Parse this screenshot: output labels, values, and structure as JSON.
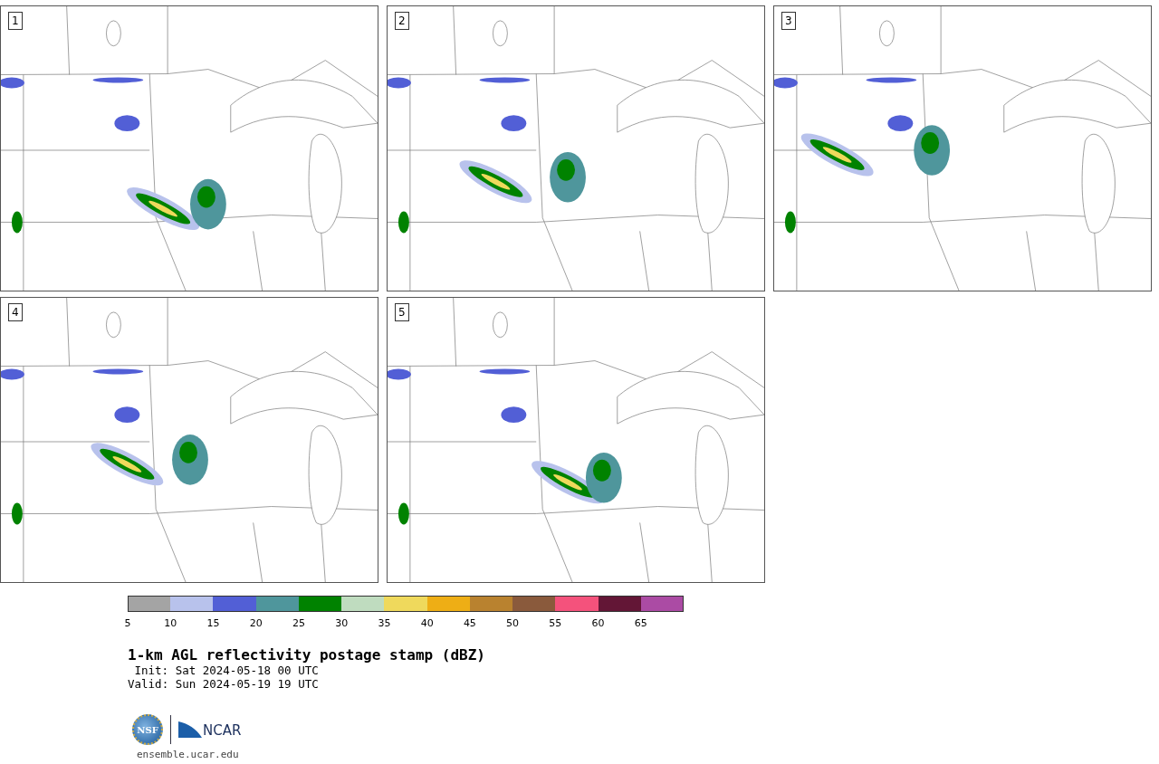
{
  "panels": [
    {
      "label": "1"
    },
    {
      "label": "2"
    },
    {
      "label": "3"
    },
    {
      "label": "4"
    },
    {
      "label": "5"
    }
  ],
  "colorbar": [
    {
      "label": "5",
      "color": "#a4a4a4"
    },
    {
      "label": "10",
      "color": "#b8c2ec"
    },
    {
      "label": "15",
      "color": "#525fd6"
    },
    {
      "label": "20",
      "color": "#4f969c"
    },
    {
      "label": "25",
      "color": "#008200"
    },
    {
      "label": "30",
      "color": "#bfdcbf"
    },
    {
      "label": "35",
      "color": "#efd95c"
    },
    {
      "label": "40",
      "color": "#eeae15"
    },
    {
      "label": "45",
      "color": "#b9822f"
    },
    {
      "label": "50",
      "color": "#8a5a3c"
    },
    {
      "label": "55",
      "color": "#f4527c"
    },
    {
      "label": "60",
      "color": "#631636"
    },
    {
      "label": "65",
      "color": "#ab4ba4"
    }
  ],
  "title": "1-km AGL reflectivity postage stamp (dBZ)",
  "init": "Init: Sat 2024-05-18 00 UTC",
  "valid": "Valid: Sun 2024-05-19 19 UTC",
  "logos": {
    "nsf": "NSF",
    "ncar": "NCAR"
  },
  "site": "ensemble.ucar.edu"
}
